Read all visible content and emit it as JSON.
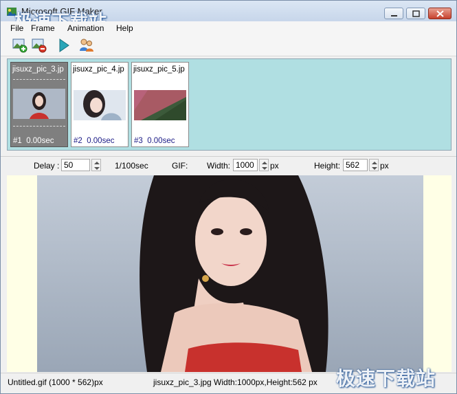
{
  "window": {
    "title": "Microsoft GIF Maker",
    "watermark": "极速下载站"
  },
  "menu": {
    "items": [
      {
        "label": "File"
      },
      {
        "label": "Frame"
      },
      {
        "label": "Animation"
      },
      {
        "label": "Help"
      }
    ]
  },
  "toolbar": {
    "buttons": [
      {
        "icon": "add-frame-icon"
      },
      {
        "icon": "remove-frame-icon"
      },
      {
        "icon": "play-icon"
      },
      {
        "icon": "users-icon"
      }
    ]
  },
  "frames": [
    {
      "name": "jisuxz_pic_3.jp",
      "number": "#1",
      "delay": "0.00sec",
      "selected": true
    },
    {
      "name": "jisuxz_pic_4.jp",
      "number": "#2",
      "delay": "0.00sec",
      "selected": false
    },
    {
      "name": "jisuxz_pic_5.jp",
      "number": "#3",
      "delay": "0.00sec",
      "selected": false
    }
  ],
  "params": {
    "delay_label": "Delay :",
    "delay_value": "50",
    "delay_unit": "1/100sec",
    "gif_label": "GIF:",
    "width_label": "Width:",
    "width_value": "1000",
    "width_unit": "px",
    "height_label": "Height:",
    "height_value": "562",
    "height_unit": "px"
  },
  "status": {
    "file": "Untitled.gif (1000 * 562)px",
    "frame": "jisuxz_pic_3.jpg Width:1000px,Height:562 px"
  },
  "colors": {
    "frames_panel_bg": "#b0dfe2",
    "preview_bg": "#ffffe6",
    "selected_frame": "#7f7f7f",
    "frame_info_text": "#1b1b86"
  }
}
